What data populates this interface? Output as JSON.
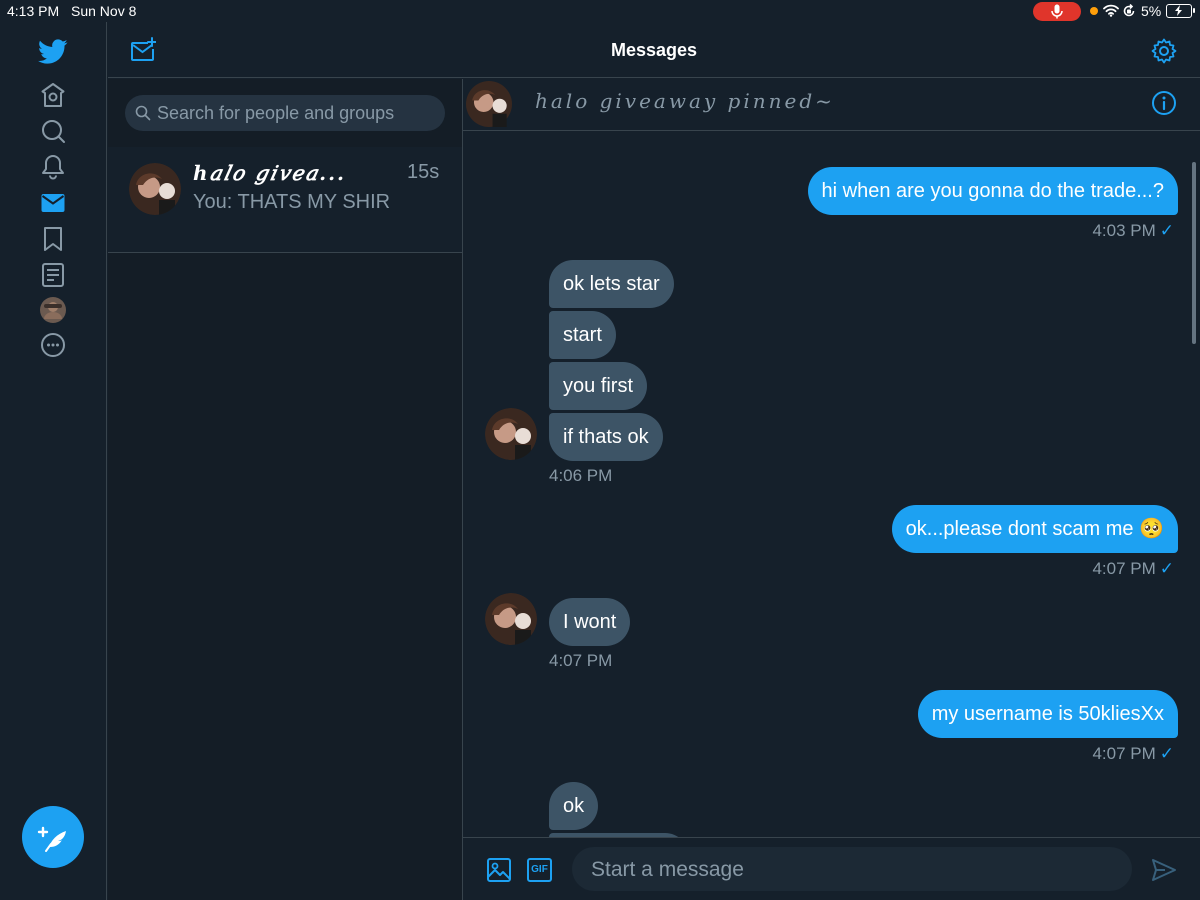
{
  "status_bar": {
    "time": "4:13 PM",
    "date": "Sun Nov 8",
    "battery": "5%"
  },
  "header": {
    "title": "Messages"
  },
  "nav": {
    "icons": [
      "twitter-logo-icon",
      "home-icon",
      "explore-icon",
      "notifications-icon",
      "messages-icon",
      "bookmarks-icon",
      "lists-icon",
      "profile-avatar",
      "more-icon"
    ],
    "active": "messages-icon"
  },
  "search": {
    "placeholder": "Search for people and groups"
  },
  "conversation": {
    "name": "ℎ𝑎𝑙𝑜 𝑔𝑖𝑣𝑒𝑎...",
    "time_ago": "15s",
    "preview": "You: THATS MY SHIR"
  },
  "chat": {
    "name": "ℎ𝑎𝑙𝑜 𝑔𝑖𝑣𝑒𝑎𝑤𝑎𝑦 𝑝𝑖𝑛𝑛𝑒𝑑~"
  },
  "messages": [
    {
      "text": "hi when are you gonna do the trade...?",
      "from": "me"
    },
    {
      "text": "4:03 PM",
      "from": "me"
    },
    {
      "text": "ok lets star",
      "from": "them"
    },
    {
      "text": "start",
      "from": "them"
    },
    {
      "text": "you first",
      "from": "them"
    },
    {
      "text": "if thats ok",
      "from": "them"
    },
    {
      "text": "4:06 PM",
      "from": "them"
    },
    {
      "text": "ok...please dont scam me 🥺",
      "from": "me"
    },
    {
      "text": "4:07 PM",
      "from": "me"
    },
    {
      "text": "I wont",
      "from": "them"
    },
    {
      "text": "4:07 PM",
      "from": "them"
    },
    {
      "text": "my username is 50kliesXx",
      "from": "me"
    },
    {
      "text": "4:07 PM",
      "from": "me"
    },
    {
      "text": "ok",
      "from": "them"
    }
  ],
  "receipt_mark": "✓",
  "composer": {
    "placeholder": "Start a message",
    "gif_label": "GIF"
  },
  "colors": {
    "background": "#15202b",
    "accent": "#1da1f2",
    "incoming_bubble": "#3d5466",
    "muted_text": "#8899a6",
    "divider": "#38444d"
  }
}
